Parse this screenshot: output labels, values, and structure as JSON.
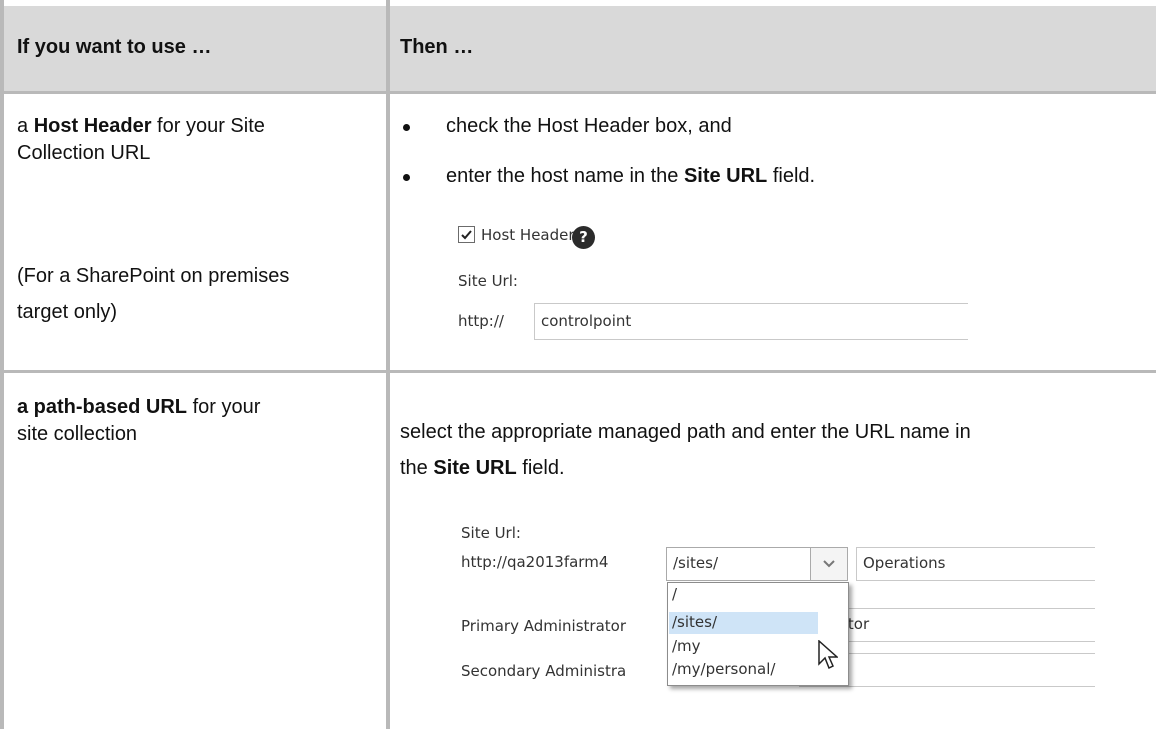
{
  "table": {
    "header": {
      "col1": "If you want to use …",
      "col2": "Then …"
    },
    "row1": {
      "col1_lead_bold": "Host Header",
      "col1_lead_prefix": "a ",
      "col1_line1_rest": " for your Site",
      "col1_line2": "Collection URL",
      "col1_note_line1": "(For a SharePoint on premises",
      "col1_note_line2": "target only)",
      "bullet1": "check the Host Header box, and",
      "bullet2_prefix": "enter the host name in the ",
      "bullet2_bold": "Site URL",
      "bullet2_suffix": " field.",
      "screenshot": {
        "checkbox_label": "Host Header",
        "help_icon": "question-circle-icon",
        "site_url_label": "Site Url:",
        "prefix": "http://",
        "value": "controlpoint"
      }
    },
    "row2": {
      "col1_bold": "a path-based URL",
      "col1_rest": " for your",
      "col1_line2": "site collection",
      "desc_line1": "select the appropriate managed path and enter the URL name in",
      "desc_line2_prefix": "the ",
      "desc_line2_bold": "Site URL",
      "desc_line2_suffix": " field.",
      "screenshot": {
        "site_url_label": "Site Url:",
        "prefix": "http://qa2013farm4",
        "selected_path": "/sites/",
        "name_value": "Operations",
        "primary_admin_label": "Primary Administrator",
        "primary_admin_value": "inistrator",
        "secondary_admin_label": "Secondary Administra",
        "options": [
          "/",
          "/sites/",
          "/my",
          "/my/personal/"
        ],
        "highlighted_option": "/sites/",
        "cursor_icon": "mouse-pointer-icon"
      }
    }
  }
}
